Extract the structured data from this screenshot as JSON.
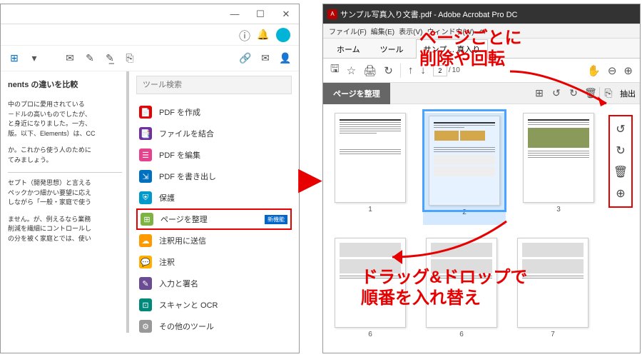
{
  "left": {
    "win_btns": [
      "—",
      "☐",
      "✕"
    ],
    "header_icons": [
      "ⓘ",
      "🔔"
    ],
    "toolbar_left": [
      "⊞",
      "▾",
      "✉",
      "✎",
      "✎̲",
      "⎘"
    ],
    "toolbar_right": [
      "🔗",
      "✉",
      "👤"
    ],
    "doc": {
      "title": "nents の違いを比較",
      "p1": "中のプロに愛用されている\n－ドルの高いものでしたが、\nと身近になりました。一方、\n版。以下、Elements）は、CC",
      "p2": "か。これから使う人のために\nてみましょう。",
      "p3": "セプト（開発思想）と言える\nペックかつ細かい要望に応え\nしながら「一般・家庭で使う",
      "p4": "ません。が、例えるなら業務\n削減を繊細にコントロールし\nの分を被く家庭とでは、使い"
    },
    "search_placeholder": "ツール検索",
    "tools": [
      {
        "icon": "📄",
        "color": "#e60000",
        "label": "PDF を作成"
      },
      {
        "icon": "📑",
        "color": "#7030a0",
        "label": "ファイルを結合"
      },
      {
        "icon": "☰",
        "color": "#e6418c",
        "label": "PDF を編集"
      },
      {
        "icon": "⇲",
        "color": "#0070c0",
        "label": "PDF を書き出し"
      },
      {
        "icon": "⛨",
        "color": "#0099cc",
        "label": "保護"
      },
      {
        "icon": "⊞",
        "color": "#7cb342",
        "label": "ページを整理",
        "hl": true,
        "badge": "新機能"
      },
      {
        "icon": "☁",
        "color": "#ff9900",
        "label": "注釈用に送信"
      },
      {
        "icon": "💬",
        "color": "#ffb000",
        "label": "注釈"
      },
      {
        "icon": "✎",
        "color": "#6a4c93",
        "label": "入力と署名"
      },
      {
        "icon": "⊡",
        "color": "#00897b",
        "label": "スキャンと OCR"
      },
      {
        "icon": "⚙",
        "color": "#999",
        "label": "その他のツール"
      }
    ]
  },
  "right": {
    "title": "サンプル写真入り文書.pdf - Adobe Acrobat Pro DC",
    "menus": [
      "ファイル(F)",
      "編集(E)",
      "表示(V)",
      "ウィンドウ(W)",
      "ヘ"
    ],
    "tabs": [
      "ホーム",
      "ツール",
      "サンプ… 真入り"
    ],
    "ribbon_left": [
      "🖫",
      "☆",
      "🖨",
      "↻"
    ],
    "ribbon_nav": [
      "↑",
      "↓"
    ],
    "page_cur": "2",
    "page_total": "10",
    "ribbon_right": [
      "✋",
      "⊖",
      "⊕"
    ],
    "sub_title": "ページを整理",
    "sub_icons": [
      "⊞",
      "↺",
      "↻",
      "🗑"
    ],
    "extract_icon": "⎘",
    "extract": "抽出",
    "page_ctrls": [
      "↺",
      "↻",
      "🗑",
      "⊕"
    ],
    "thumbs": [
      1,
      2,
      3,
      6,
      6,
      7
    ]
  },
  "anno": {
    "a1": "ページごとに\n削除や回転",
    "a2": "ドラッグ&ドロップで\n順番を入れ替え"
  }
}
